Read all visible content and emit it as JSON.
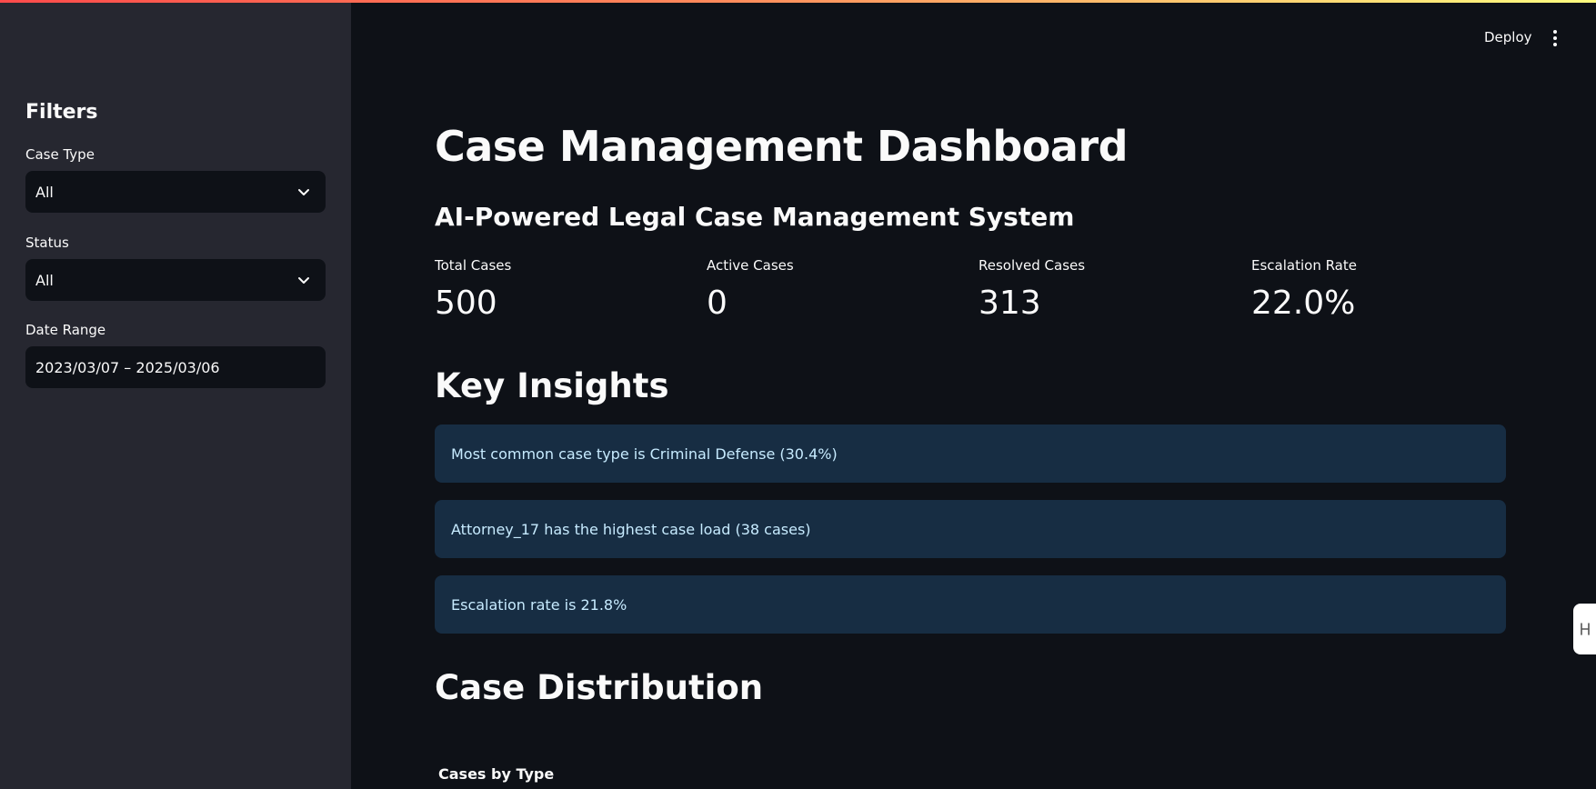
{
  "header": {
    "deploy_label": "Deploy"
  },
  "sidebar": {
    "title": "Filters",
    "case_type": {
      "label": "Case Type",
      "value": "All"
    },
    "status": {
      "label": "Status",
      "value": "All"
    },
    "date_range": {
      "label": "Date Range",
      "value": "2023/03/07 – 2025/03/06"
    }
  },
  "main": {
    "title": "Case Management Dashboard",
    "subtitle": "AI-Powered Legal Case Management System",
    "metrics": [
      {
        "label": "Total Cases",
        "value": "500"
      },
      {
        "label": "Active Cases",
        "value": "0"
      },
      {
        "label": "Resolved Cases",
        "value": "313"
      },
      {
        "label": "Escalation Rate",
        "value": "22.0%"
      }
    ],
    "insights_heading": "Key Insights",
    "insights": [
      "Most common case type is Criminal Defense (30.4%)",
      "Attorney_17 has the highest case load (38 cases)",
      "Escalation rate is 21.8%"
    ],
    "distribution_heading": "Case Distribution",
    "chart_title": "Cases by Type"
  },
  "icons": {
    "select_chevron": "chevron-down-icon",
    "menu": "kebab-menu-icon",
    "edge_handle": "expand-handle-icon"
  },
  "colors": {
    "background": "#0e1117",
    "sidebar": "#262730",
    "insight_bg": "#172d43",
    "insight_text": "#c7ebff",
    "accent_gradient_start": "#ff4b4b",
    "accent_gradient_end": "#fffd80"
  }
}
